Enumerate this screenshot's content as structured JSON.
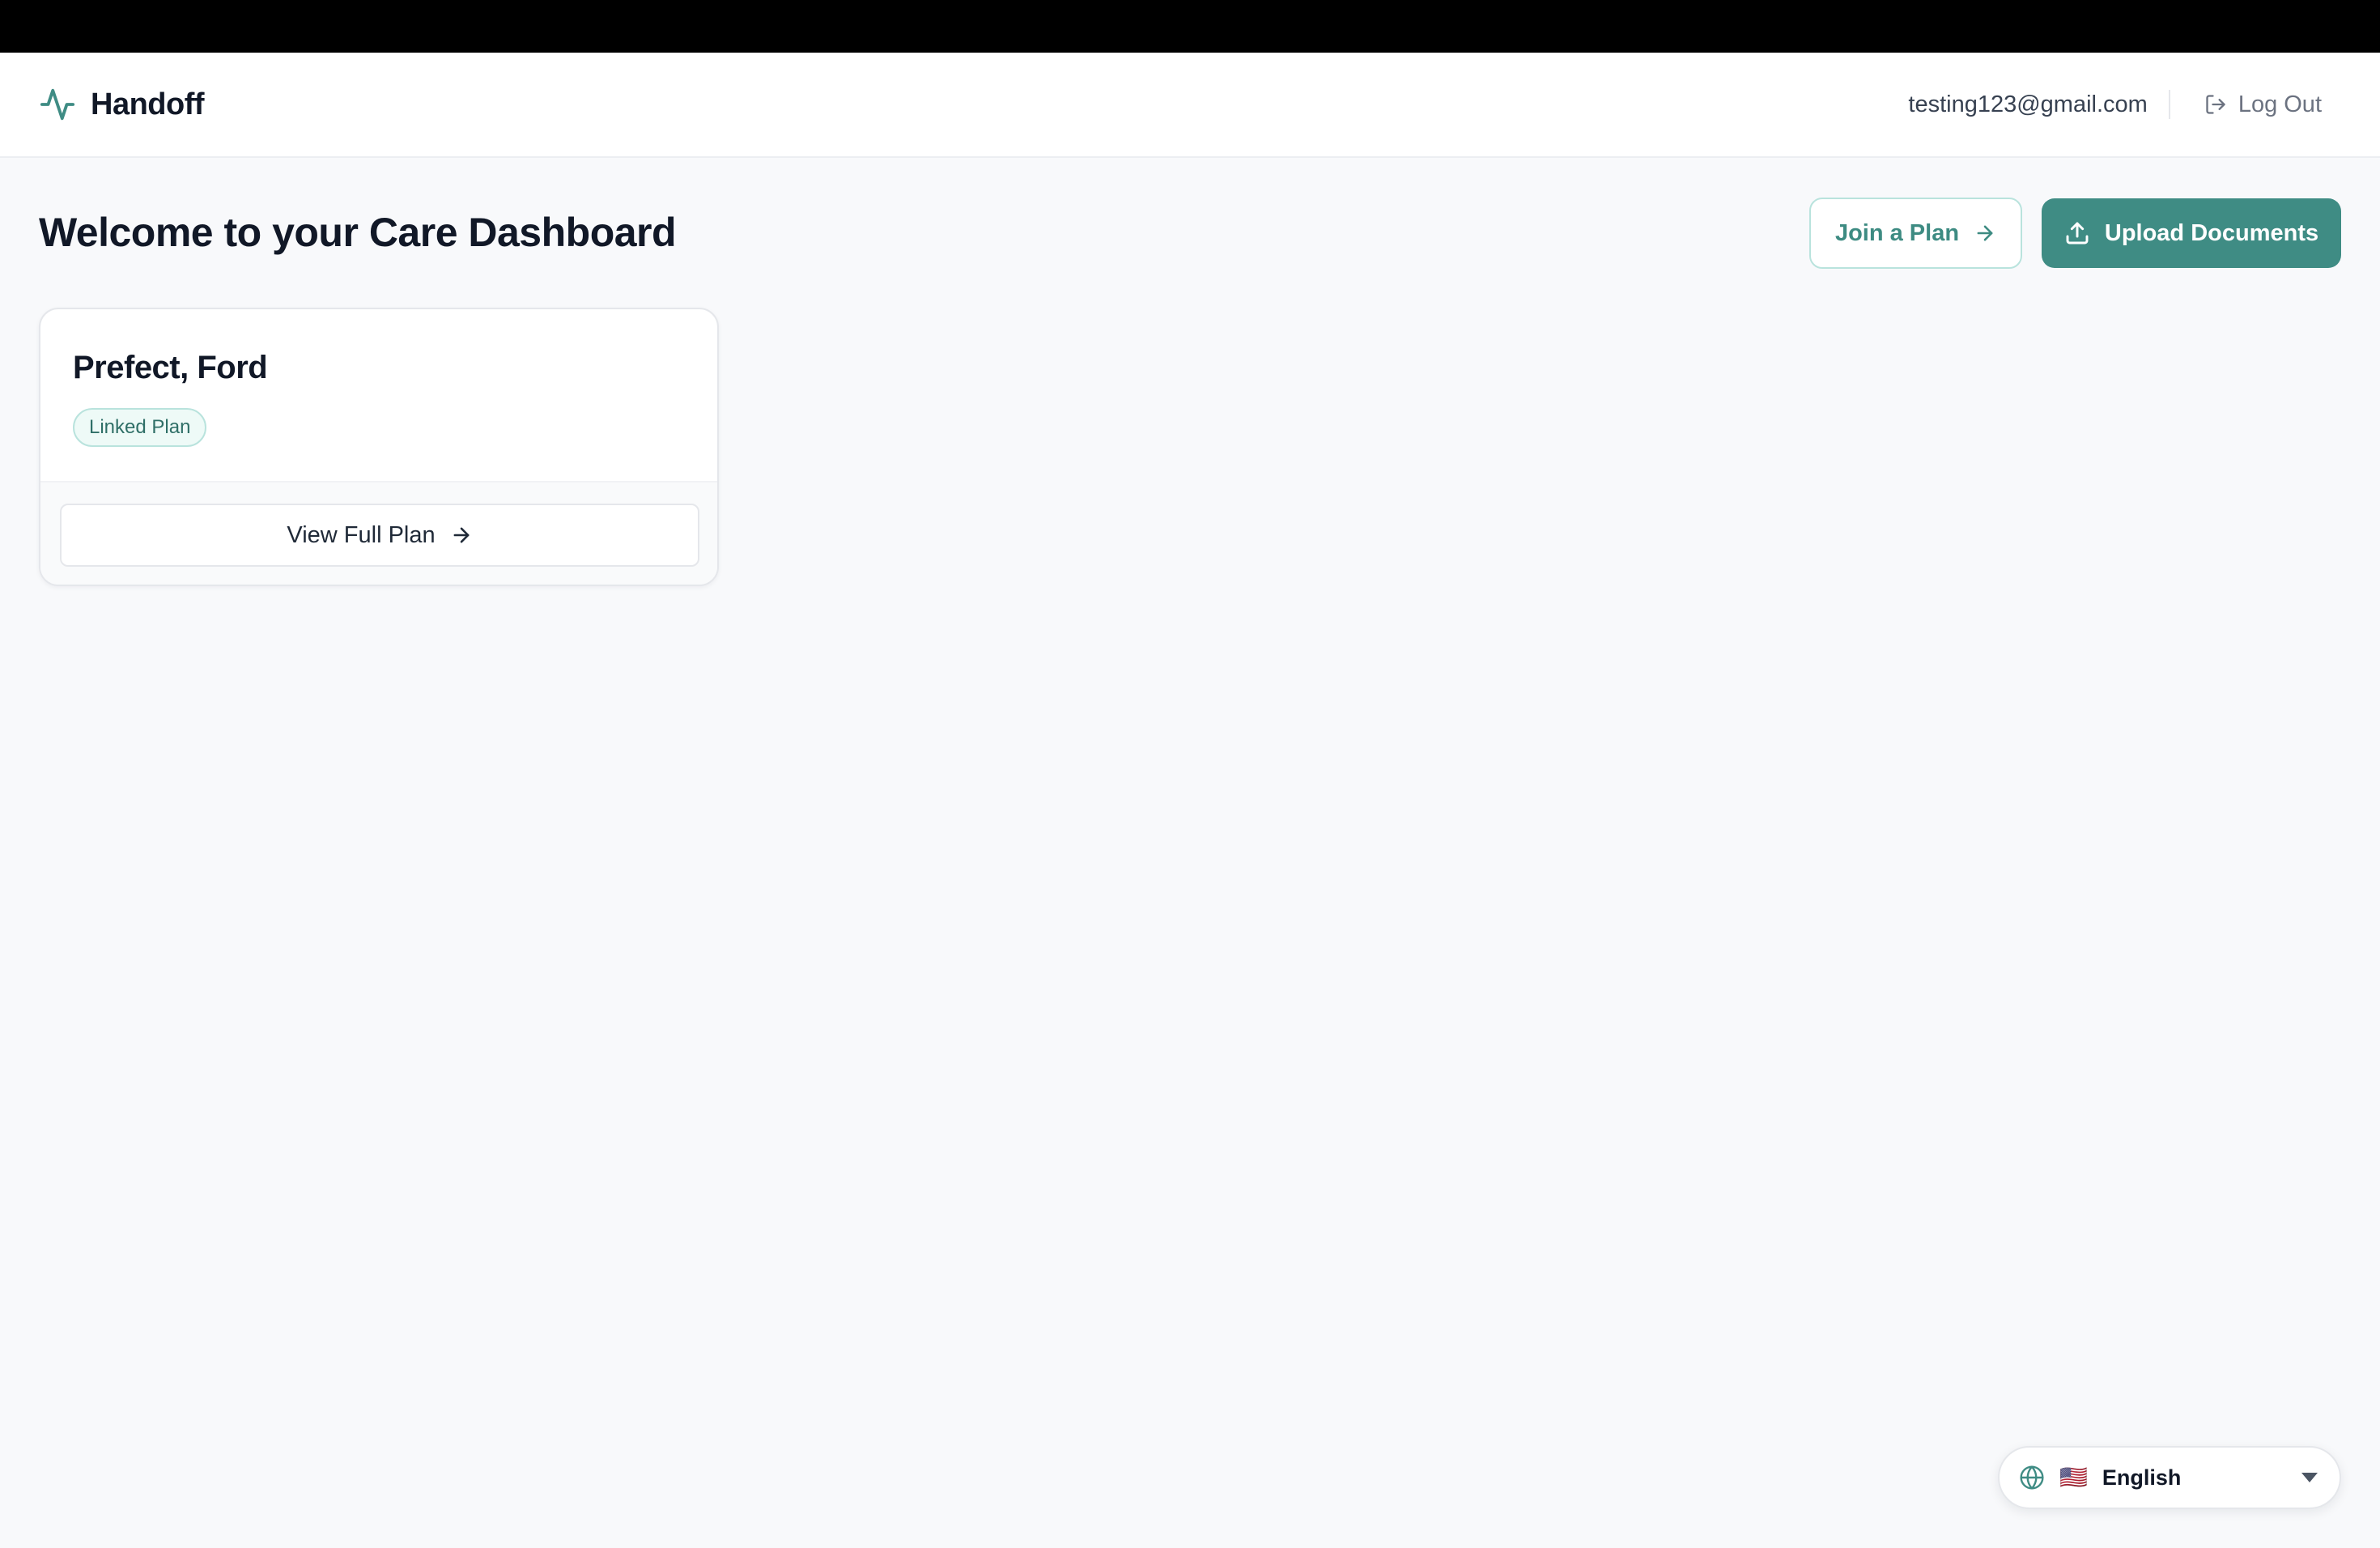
{
  "app": {
    "name": "Handoff"
  },
  "header": {
    "user_email": "testing123@gmail.com",
    "logout_label": "Log Out"
  },
  "main": {
    "title": "Welcome to your Care Dashboard",
    "join_label": "Join a Plan",
    "upload_label": "Upload Documents"
  },
  "plans": [
    {
      "name": "Prefect, Ford",
      "badge": "Linked Plan",
      "view_label": "View Full Plan"
    }
  ],
  "language": {
    "flag": "🇺🇸",
    "selected": "English"
  },
  "icons": {
    "brand": "pulse-icon",
    "logout": "logout-icon",
    "join": "arrow-right-icon",
    "upload": "upload-icon",
    "view": "arrow-right-icon",
    "language": "globe-icon",
    "dropdown": "caret-down-icon"
  },
  "colors": {
    "brand": "#3f8c84",
    "brand_light_border": "#b9e3dd",
    "badge_bg": "#eefaf7",
    "page_bg": "#f8f9fb",
    "text_dark": "#111827"
  }
}
